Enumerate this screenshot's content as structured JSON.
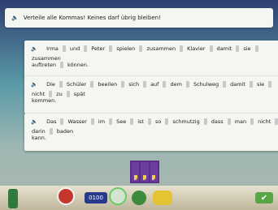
{
  "instruction": "Verteile alle Kommas! Keines darf übrig bleiben!",
  "cards": [
    {
      "line1": [
        "Irma",
        "und",
        "Peter",
        "spielen",
        "zusammen",
        "Klavier",
        "damit",
        "sie",
        "zusammen"
      ],
      "line2": [
        "auftreten",
        "können."
      ]
    },
    {
      "line1": [
        "Die",
        "Schüler",
        "beeilen",
        "sich",
        "auf",
        "dem",
        "Schulweg",
        "damit",
        "sie",
        "nicht",
        "zu",
        "spät"
      ],
      "line2": [
        "kommen."
      ]
    },
    {
      "line1": [
        "Das",
        "Wasser",
        "im",
        "See",
        "ist",
        "so",
        "schmutzig",
        "dass",
        "man",
        "nicht",
        "darin",
        "baden"
      ],
      "line2": [
        "kann."
      ]
    }
  ],
  "bottom": {
    "timer": "0100",
    "check": "✔"
  }
}
